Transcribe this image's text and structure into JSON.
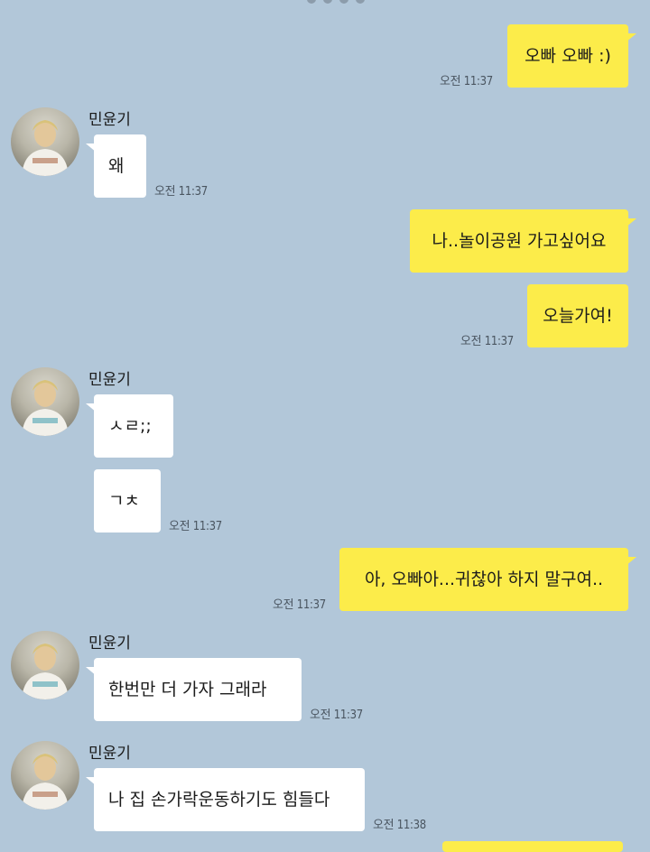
{
  "contact": {
    "name": "민윤기"
  },
  "messages": [
    {
      "from": "me",
      "text": "오빠 오빠 :)",
      "time": "오전 11:37"
    },
    {
      "from": "them",
      "text": "왜",
      "time": "오전 11:37"
    },
    {
      "from": "me",
      "text": "나..놀이공원 가고싶어요",
      "time": ""
    },
    {
      "from": "me",
      "text": "오늘가여!",
      "time": "오전 11:37"
    },
    {
      "from": "them",
      "text": "ㅅㄹ;;",
      "time": ""
    },
    {
      "from": "them",
      "text": "ㄱㅊ",
      "time": "오전 11:37"
    },
    {
      "from": "me",
      "text": "아, 오빠아...귀찮아 하지 말구여..",
      "time": "오전 11:37"
    },
    {
      "from": "them",
      "text": "한번만 더 가자 그래라",
      "time": "오전 11:37"
    },
    {
      "from": "them",
      "text": "나 집 손가락운동하기도 힘들다",
      "time": "오전 11:38"
    }
  ],
  "colors": {
    "background": "#b2c7d9",
    "my_bubble": "#fcec4a",
    "their_bubble": "#ffffff"
  }
}
